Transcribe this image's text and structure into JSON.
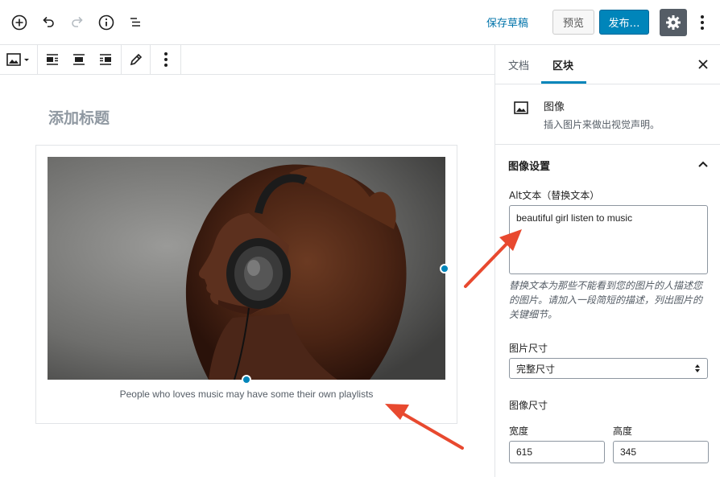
{
  "topbar": {
    "save_draft": "保存草稿",
    "preview": "预览",
    "publish": "发布…",
    "icons": [
      "add-block-icon",
      "undo-icon",
      "redo-icon",
      "info-icon",
      "outline-icon",
      "gear-icon",
      "more-icon"
    ]
  },
  "block_toolbar": {
    "icons": [
      "image-icon",
      "align-left-icon",
      "align-center-icon",
      "align-right-icon",
      "edit-icon",
      "more-icon"
    ]
  },
  "editor": {
    "title_placeholder": "添加标题",
    "caption": "People who loves music may have some their own playlists"
  },
  "sidebar": {
    "tabs": [
      {
        "label": "文档",
        "active": false
      },
      {
        "label": "区块",
        "active": true
      }
    ],
    "block_name": "图像",
    "block_desc": "插入图片来做出视觉声明。",
    "panel_title": "图像设置",
    "alt_label": "Alt文本（替换文本）",
    "alt_value": "beautiful girl listen to music",
    "alt_help": "替换文本为那些不能看到您的图片的人描述您的图片。请加入一段简短的描述，列出图片的关键细节。",
    "size_label": "图片尺寸",
    "size_value": "完整尺寸",
    "dimensions_label": "图像尺寸",
    "width_label": "宽度",
    "width_value": "615",
    "height_label": "高度",
    "height_value": "345"
  },
  "colors": {
    "accent": "#0085ba",
    "link": "#0073aa",
    "annotation_arrow": "#e8492f"
  }
}
